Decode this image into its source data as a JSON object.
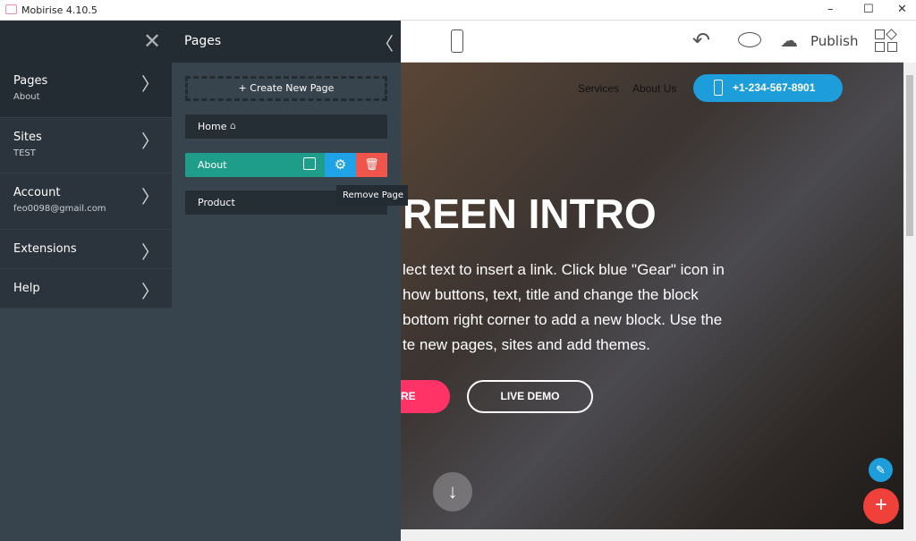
{
  "window": {
    "title": "Mobirise 4.10.5",
    "minimize": "–",
    "maximize": "☐",
    "close": "✕"
  },
  "sidebar": {
    "items": [
      {
        "label": "Pages",
        "sub": "About"
      },
      {
        "label": "Sites",
        "sub": "TEST"
      },
      {
        "label": "Account",
        "sub": "feo0098@gmail.com"
      },
      {
        "label": "Extensions"
      },
      {
        "label": "Help"
      }
    ]
  },
  "pages_panel": {
    "title": "Pages",
    "create": "+ Create New Page",
    "pages": [
      "Home",
      "About",
      "Product"
    ],
    "tooltip": "Remove Page",
    "colors": {
      "active": "#1e9e8a",
      "gear": "#1fa3e6",
      "trash": "#f0554c"
    }
  },
  "toolbar": {
    "publish": "Publish"
  },
  "preview": {
    "nav": [
      "Services",
      "About Us"
    ],
    "phone": "+1-234-567-8901",
    "heading": "REEN INTRO",
    "body": [
      "lect text to insert a link. Click blue \"Gear\" icon in",
      "how buttons, text, title and change the block",
      "bottom right corner to add a new block. Use the",
      "te new pages, sites and add themes."
    ],
    "btn1": "RE",
    "btn2": "LIVE DEMO"
  }
}
